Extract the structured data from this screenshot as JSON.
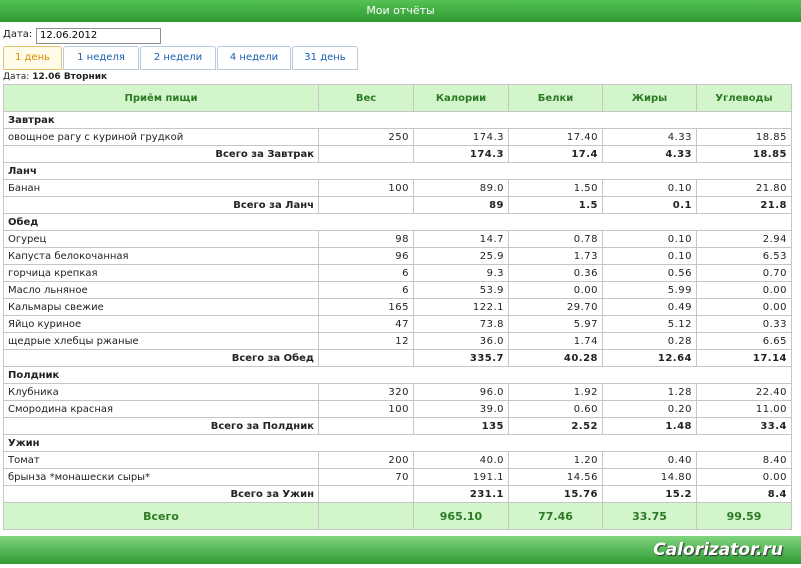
{
  "window": {
    "title": "Мои отчёты"
  },
  "filter": {
    "date_label": "Дата:",
    "date_value": "12.06.2012"
  },
  "tabs": [
    {
      "label": "1 день",
      "active": true
    },
    {
      "label": "1 неделя",
      "active": false
    },
    {
      "label": "2 недели",
      "active": false
    },
    {
      "label": "4 недели",
      "active": false
    },
    {
      "label": "31 день",
      "active": false
    }
  ],
  "subheader": {
    "label": "Дата:",
    "value": "12.06 Вторник"
  },
  "table": {
    "headers": [
      "Приём пищи",
      "Вес",
      "Калории",
      "Белки",
      "Жиры",
      "Углеводы"
    ],
    "sections": [
      {
        "name": "Завтрак",
        "rows": [
          [
            "овощное рагу с куриной грудкой",
            "250",
            "174.3",
            "17.40",
            "4.33",
            "18.85"
          ]
        ],
        "subtotal": [
          "Всего за Завтрак",
          "",
          "174.3",
          "17.4",
          "4.33",
          "18.85"
        ]
      },
      {
        "name": "Ланч",
        "rows": [
          [
            "Банан",
            "100",
            "89.0",
            "1.50",
            "0.10",
            "21.80"
          ]
        ],
        "subtotal": [
          "Всего за Ланч",
          "",
          "89",
          "1.5",
          "0.1",
          "21.8"
        ]
      },
      {
        "name": "Обед",
        "rows": [
          [
            "Огурец",
            "98",
            "14.7",
            "0.78",
            "0.10",
            "2.94"
          ],
          [
            "Капуста белокочанная",
            "96",
            "25.9",
            "1.73",
            "0.10",
            "6.53"
          ],
          [
            "горчица крепкая",
            "6",
            "9.3",
            "0.36",
            "0.56",
            "0.70"
          ],
          [
            "Масло льняное",
            "6",
            "53.9",
            "0.00",
            "5.99",
            "0.00"
          ],
          [
            "Кальмары свежие",
            "165",
            "122.1",
            "29.70",
            "0.49",
            "0.00"
          ],
          [
            "Яйцо куриное",
            "47",
            "73.8",
            "5.97",
            "5.12",
            "0.33"
          ],
          [
            "щедрые хлебцы ржаные",
            "12",
            "36.0",
            "1.74",
            "0.28",
            "6.65"
          ]
        ],
        "subtotal": [
          "Всего за Обед",
          "",
          "335.7",
          "40.28",
          "12.64",
          "17.14"
        ]
      },
      {
        "name": "Полдник",
        "rows": [
          [
            "Клубника",
            "320",
            "96.0",
            "1.92",
            "1.28",
            "22.40"
          ],
          [
            "Смородина красная",
            "100",
            "39.0",
            "0.60",
            "0.20",
            "11.00"
          ]
        ],
        "subtotal": [
          "Всего за Полдник",
          "",
          "135",
          "2.52",
          "1.48",
          "33.4"
        ]
      },
      {
        "name": "Ужин",
        "rows": [
          [
            "Томат",
            "200",
            "40.0",
            "1.20",
            "0.40",
            "8.40"
          ],
          [
            "брынза *монашески сыры*",
            "70",
            "191.1",
            "14.56",
            "14.80",
            "0.00"
          ]
        ],
        "subtotal": [
          "Всего за Ужин",
          "",
          "231.1",
          "15.76",
          "15.2",
          "8.4"
        ]
      }
    ],
    "total": [
      "Всего",
      "",
      "965.10",
      "77.46",
      "33.75",
      "99.59"
    ]
  },
  "footer": {
    "brand": "Calorizator.ru"
  },
  "colors": {
    "titlebar": "#3aa83a",
    "header_bg": "#d2f5cc",
    "header_text": "#2d7a24",
    "tab_active": "#d98b00",
    "tab_text": "#1a5fb4"
  }
}
